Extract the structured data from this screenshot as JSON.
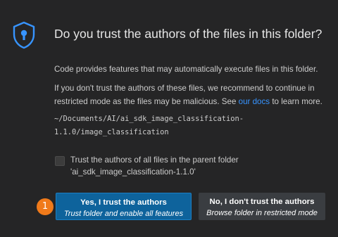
{
  "dialog": {
    "title": "Do you trust the authors of the files in this folder?",
    "paragraph1": "Code provides features that may automatically execute files in this folder.",
    "paragraph2_line1": "If you don't trust the authors of these files, we recommend to continue in",
    "paragraph2_prefix": "restricted mode as the files may be malicious. See ",
    "paragraph2_link": "our docs",
    "paragraph2_suffix": " to learn more.",
    "folder_path_line1": "~/Documents/AI/ai_sdk_image_classification-",
    "folder_path_line2": "1.1.0/image_classification",
    "checkbox_label_line1": "Trust the authors of all files in the parent folder",
    "checkbox_label_line2": "'ai_sdk_image_classification-1.1.0'",
    "checkbox_checked": false
  },
  "buttons": {
    "trust_main": "Yes, I trust the authors",
    "trust_sub": "Trust folder and enable all features",
    "distrust_main": "No, I don't trust the authors",
    "distrust_sub": "Browse folder in restricted mode"
  },
  "annotation": {
    "badge_number": "1",
    "badge_color": "#f07a1a"
  },
  "icons": {
    "shield": "shield-lock-icon"
  },
  "colors": {
    "background": "#252526",
    "primary_button": "#0e639c",
    "secondary_button": "#3a3d41",
    "link": "#3794ff"
  }
}
